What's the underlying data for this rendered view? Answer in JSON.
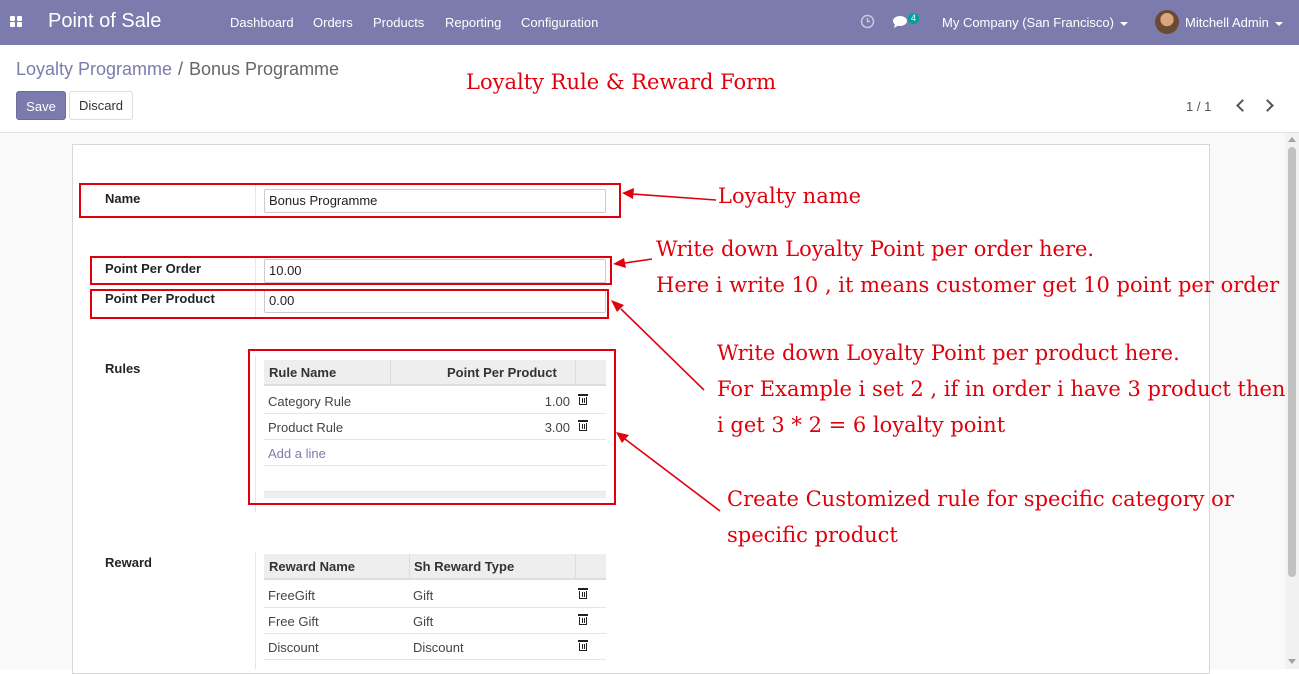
{
  "navbar": {
    "brand": "Point of Sale",
    "menu": [
      "Dashboard",
      "Orders",
      "Products",
      "Reporting",
      "Configuration"
    ],
    "messages_count": "4",
    "company": "My Company (San Francisco)",
    "user": "Mitchell Admin",
    "bg_color": "#7c7bad"
  },
  "breadcrumb": {
    "parent": "Loyalty Programme",
    "separator": "/",
    "current": "Bonus Programme"
  },
  "buttons": {
    "save": "Save",
    "discard": "Discard"
  },
  "pager": {
    "text": "1 / 1"
  },
  "form": {
    "name_label": "Name",
    "name_value": "Bonus Programme",
    "point_per_order_label": "Point Per Order",
    "point_per_order_value": "10.00",
    "point_per_product_label": "Point Per Product",
    "point_per_product_value": "0.00",
    "rules_label": "Rules",
    "rules": {
      "columns": [
        "Rule Name",
        "Point Per Product"
      ],
      "rows": [
        {
          "name": "Category Rule",
          "points": "1.00"
        },
        {
          "name": "Product Rule",
          "points": "3.00"
        }
      ],
      "add_line": "Add a line"
    },
    "reward_label": "Reward",
    "rewards": {
      "columns": [
        "Reward Name",
        "Sh Reward Type"
      ],
      "rows": [
        {
          "name": "FreeGift",
          "type": "Gift"
        },
        {
          "name": "Free Gift",
          "type": "Gift"
        },
        {
          "name": "Discount",
          "type": "Discount"
        }
      ]
    }
  },
  "annotations": {
    "title": "Loyalty Rule & Reward Form",
    "loyalty_name": "Loyalty name",
    "per_order_1": "Write down Loyalty Point per order here.",
    "per_order_2": "Here i write 10 , it means customer get 10 point per order",
    "per_product_1": "Write down Loyalty Point per product here.",
    "per_product_2": "For Example i set 2 , if in order i have 3 product then",
    "per_product_3": "i get 3 * 2 = 6 loyalty point",
    "rules_1": "Create Customized rule for specific category or",
    "rules_2": "specific product",
    "color": "#e0000c"
  }
}
